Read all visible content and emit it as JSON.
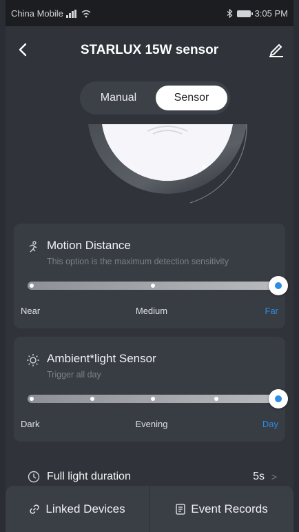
{
  "status": {
    "carrier": "China Mobile",
    "time": "3:05 PM"
  },
  "header": {
    "title": "STARLUX 15W sensor"
  },
  "mode": {
    "manual_label": "Manual",
    "sensor_label": "Sensor",
    "selected": "Sensor"
  },
  "motion": {
    "title": "Motion Distance",
    "subtitle": "This option is the maximum detection sensitivity",
    "labels": [
      "Near",
      "Medium",
      "Far"
    ],
    "selected_fraction": 1.0
  },
  "ambient": {
    "title": "Ambient*light Sensor",
    "subtitle": "Trigger all day",
    "labels": [
      "Dark",
      "Evening",
      "Day"
    ],
    "selected_fraction": 1.0
  },
  "duration": {
    "label": "Full light duration",
    "value": "5s",
    "chevron": ">"
  },
  "bottom": {
    "linked_label": "Linked Devices",
    "records_label": "Event Records"
  },
  "colors": {
    "accent": "#2b8de3",
    "background": "#30343a",
    "card": "#383c43"
  },
  "icons": {
    "back": "back-arrow-icon",
    "edit": "edit-pencil-icon",
    "motion": "motion-run-icon",
    "ambient": "sun-icon",
    "clock": "clock-icon",
    "link": "link-icon",
    "records": "document-icon"
  }
}
